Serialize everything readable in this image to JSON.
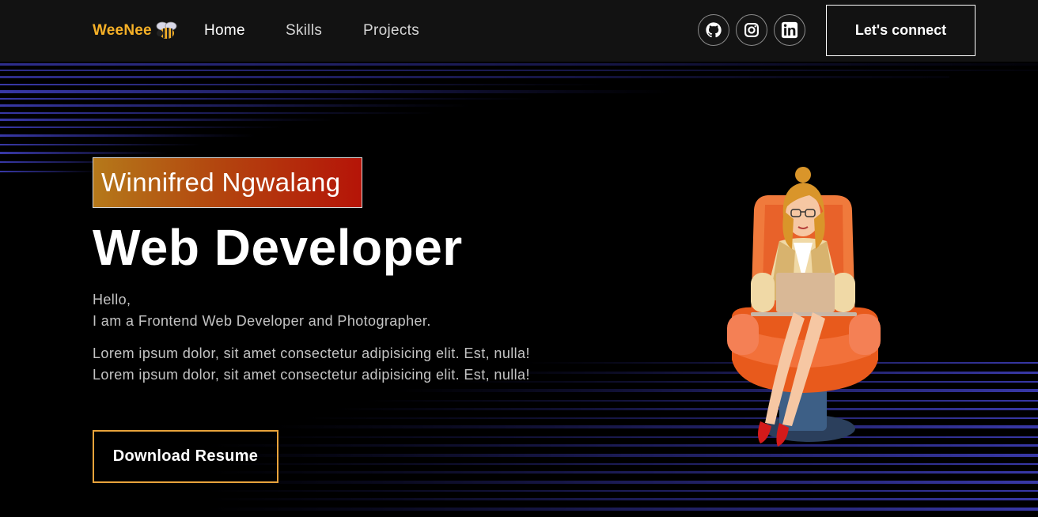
{
  "nav": {
    "logo_text": "WeeNee",
    "links": [
      {
        "label": "Home"
      },
      {
        "label": "Skills"
      },
      {
        "label": "Projects"
      }
    ],
    "social_icons": [
      "github-icon",
      "instagram-icon",
      "linkedin-icon"
    ],
    "connect_label": "Let's connect"
  },
  "hero": {
    "name": "Winnifred Ngwalang",
    "title": "Web Developer",
    "greeting": "Hello,",
    "intro": "I am a Frontend Web Developer and Photographer.",
    "lorem_1": "Lorem ipsum dolor, sit amet consectetur adipisicing elit. Est, nulla!",
    "lorem_2": "Lorem ipsum dolor, sit amet consectetur adipisicing elit. Est, nulla!",
    "resume_label": "Download Resume"
  },
  "colors": {
    "accent": "#f5b027",
    "button_border": "#e8a33b",
    "badge_start": "#b5791a",
    "badge_end": "#b51408",
    "lines": "#3a3aa8"
  }
}
